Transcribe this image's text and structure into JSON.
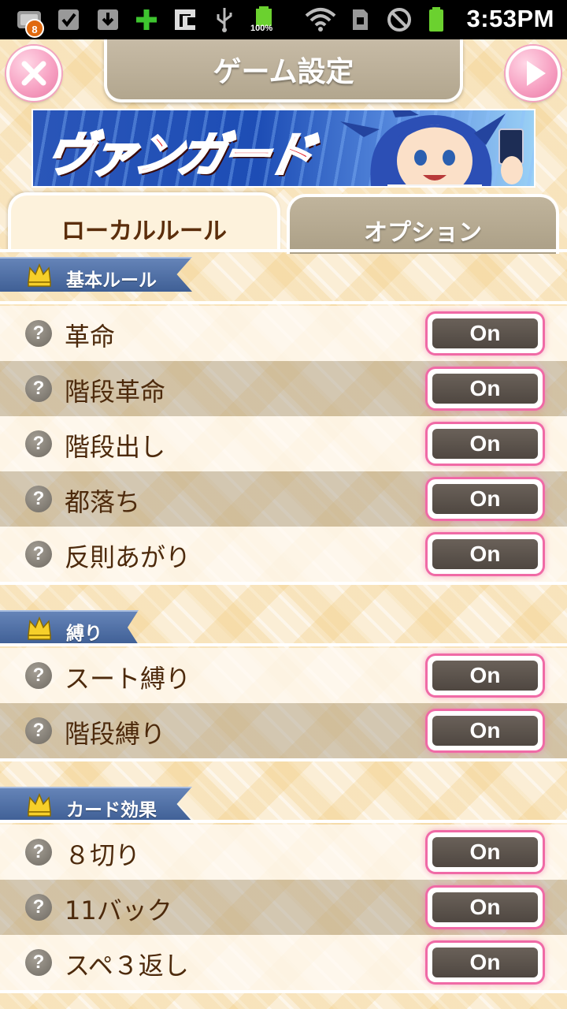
{
  "status_bar": {
    "notification_count": "8",
    "battery_level": "100%",
    "time": "3:53PM",
    "icons": [
      "notification-icon",
      "checkbox-icon",
      "download-icon",
      "plus-icon",
      "app-icon",
      "usb-icon",
      "battery-icon",
      "wifi-icon",
      "sd-card-icon",
      "no-sim-icon",
      "battery-full-icon"
    ]
  },
  "header": {
    "title": "ゲーム設定",
    "close_icon": "close-icon",
    "play_icon": "play-icon"
  },
  "banner": {
    "logo_text": "ヴァンガード"
  },
  "tabs": [
    {
      "label": "ローカルルール",
      "active": true
    },
    {
      "label": "オプション",
      "active": false
    }
  ],
  "sections": [
    {
      "title": "基本ルール",
      "rows": [
        {
          "label": "革命",
          "toggle": "On"
        },
        {
          "label": "階段革命",
          "toggle": "On"
        },
        {
          "label": "階段出し",
          "toggle": "On"
        },
        {
          "label": "都落ち",
          "toggle": "On"
        },
        {
          "label": "反則あがり",
          "toggle": "On"
        }
      ]
    },
    {
      "title": "縛り",
      "rows": [
        {
          "label": "スート縛り",
          "toggle": "On"
        },
        {
          "label": "階段縛り",
          "toggle": "On"
        }
      ]
    },
    {
      "title": "カード効果",
      "rows": [
        {
          "label": "８切り",
          "toggle": "On"
        },
        {
          "label": "11バック",
          "toggle": "On"
        },
        {
          "label": "スペ３返し",
          "toggle": "On"
        }
      ]
    }
  ],
  "help_glyph": "?",
  "colors": {
    "toggle_glow": "#f06aa6",
    "section_header": "#4a6aa2",
    "label_text": "#4d2a0c",
    "title_bar": "#bcb098"
  }
}
